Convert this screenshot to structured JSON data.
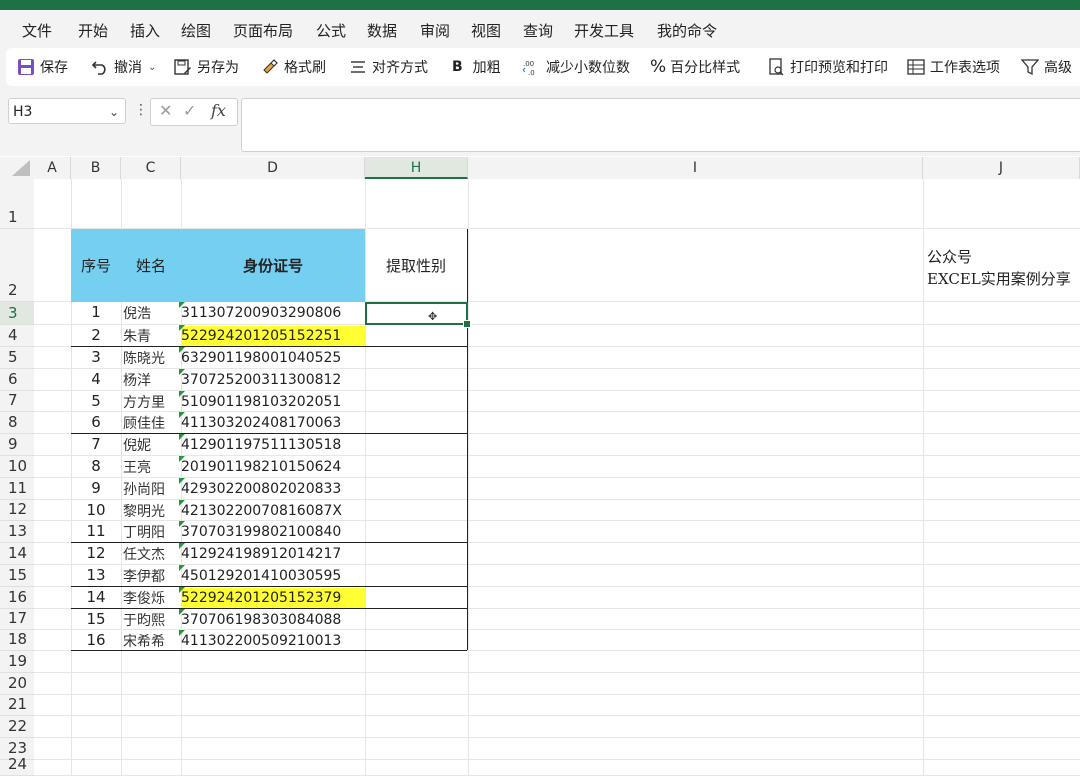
{
  "menu": [
    "文件",
    "开始",
    "插入",
    "绘图",
    "页面布局",
    "公式",
    "数据",
    "审阅",
    "视图",
    "查询",
    "开发工具",
    "我的命令"
  ],
  "toolbar": {
    "save": "保存",
    "undo": "撤消",
    "save_as": "另存为",
    "format_painter": "格式刷",
    "align": "对齐方式",
    "bold_icon": "B",
    "bold": "加粗",
    "decrease_decimal": "减少小数位数",
    "percent": "百分比样式",
    "print_preview": "打印预览和打印",
    "sheet_options": "工作表选项",
    "advanced": "高级"
  },
  "name_box": "H3",
  "formula_bar": "",
  "columns": [
    "A",
    "B",
    "C",
    "D",
    "H",
    "I",
    "J"
  ],
  "selected_column": "H",
  "row_numbers": [
    "1",
    "2",
    "3",
    "4",
    "5",
    "6",
    "7",
    "8",
    "9",
    "10",
    "11",
    "12",
    "13",
    "14",
    "15",
    "16",
    "17",
    "18",
    "19",
    "20",
    "21",
    "22",
    "23",
    "24"
  ],
  "table_headers": {
    "seq": "序号",
    "name": "姓名",
    "id": "身份证号",
    "gender": "提取性别"
  },
  "rows": [
    {
      "seq": "1",
      "name": "倪浩",
      "id": "311307200903290806"
    },
    {
      "seq": "2",
      "name": "朱青",
      "id": "522924201205152251",
      "highlight": true
    },
    {
      "seq": "3",
      "name": "陈晓光",
      "id": "632901198001040525"
    },
    {
      "seq": "4",
      "name": "杨洋",
      "id": "370725200311300812"
    },
    {
      "seq": "5",
      "name": "方方里",
      "id": "510901198103202051"
    },
    {
      "seq": "6",
      "name": "顾佳佳",
      "id": "411303202408170063"
    },
    {
      "seq": "7",
      "name": "倪妮",
      "id": "412901197511130518"
    },
    {
      "seq": "8",
      "name": "王亮",
      "id": "201901198210150624"
    },
    {
      "seq": "9",
      "name": "孙尚阳",
      "id": "429302200802020833"
    },
    {
      "seq": "10",
      "name": "黎明光",
      "id": "42130220070816087X"
    },
    {
      "seq": "11",
      "name": "丁明阳",
      "id": "370703199802100840"
    },
    {
      "seq": "12",
      "name": "任文杰",
      "id": "412924198912014217"
    },
    {
      "seq": "13",
      "name": "李伊都",
      "id": "450129201410030595"
    },
    {
      "seq": "14",
      "name": "李俊烁",
      "id": "522924201205152379",
      "highlight": true
    },
    {
      "seq": "15",
      "name": "于昀熙",
      "id": "370706198303084088"
    },
    {
      "seq": "16",
      "name": "宋希希",
      "id": "411302200509210013"
    }
  ],
  "note": {
    "line1": "公众号",
    "line2": "EXCEL实用案例分享"
  }
}
